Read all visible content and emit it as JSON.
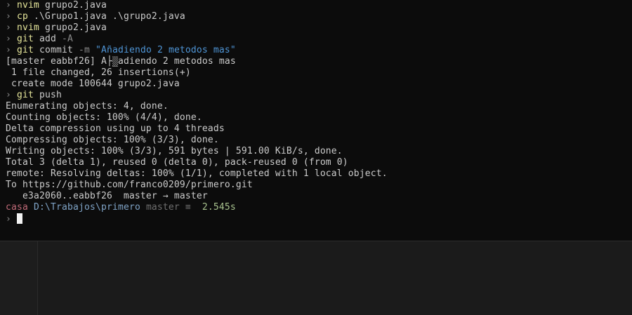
{
  "terminal": {
    "prompt_symbol": "›",
    "history": [
      {
        "cmd": "nvim",
        "args": " grupo2.java"
      },
      {
        "cmd": "cp",
        "args": " .\\Grupo1.java .\\grupo2.java"
      },
      {
        "cmd": "nvim",
        "args": " grupo2.java"
      },
      {
        "cmd": "git",
        "args": " add ",
        "flag": "-A"
      },
      {
        "cmd": "git",
        "args": " commit ",
        "flag": "-m",
        "string": "\"Añadiendo 2 metodos mas\""
      }
    ],
    "commit_output": {
      "prefix": "[master eabbf26] A",
      "garbled": "├",
      "garbled2": "▒",
      "suffix": "adiendo 2 metodos mas",
      "lines": [
        " 1 file changed, 26 insertions(+)",
        " create mode 100644 grupo2.java"
      ]
    },
    "push_command": {
      "cmd": "git",
      "args": " push"
    },
    "push_output": [
      "Enumerating objects: 4, done.",
      "Counting objects: 100% (4/4), done.",
      "Delta compression using up to 4 threads",
      "Compressing objects: 100% (3/3), done.",
      "Writing objects: 100% (3/3), 591 bytes | 591.00 KiB/s, done.",
      "Total 3 (delta 1), reused 0 (delta 0), pack-reused 0 (from 0)",
      "remote: Resolving deltas: 100% (1/1), completed with 1 local object.",
      "To https://github.com/franco0209/primero.git",
      "   e3a2060..eabbf26  master → master"
    ],
    "status_line": {
      "user": "casa",
      "path": "D:\\Trabajos\\primero",
      "branch": "master ≡",
      "duration": "2.545s"
    }
  },
  "colors": {
    "background": "#0c0c0c",
    "command": "#e5e59a",
    "string": "#4f95d6",
    "user": "#c06a78",
    "path": "#7fa3c6",
    "duration": "#a9c38f"
  }
}
